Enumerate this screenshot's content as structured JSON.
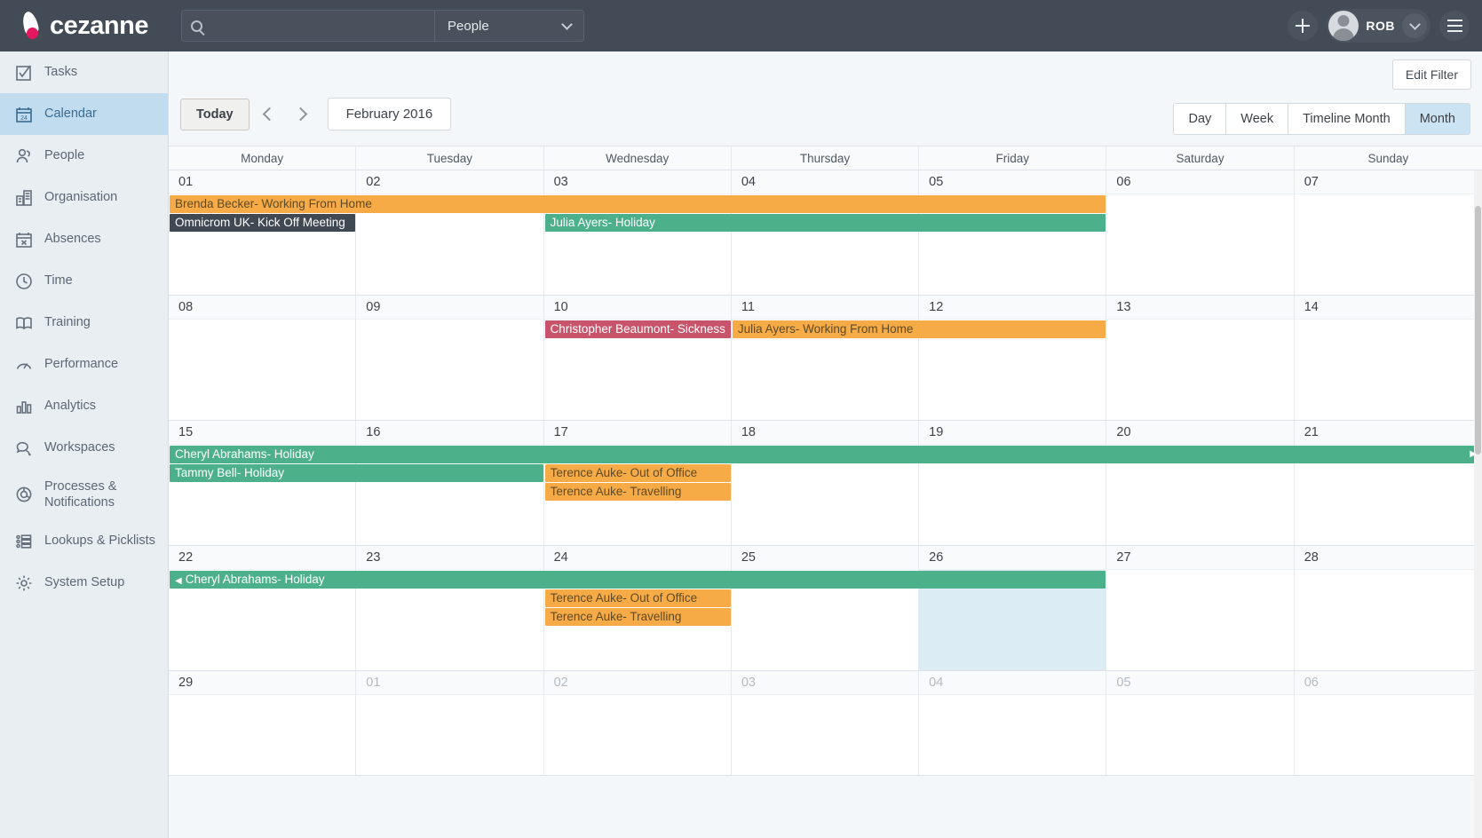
{
  "header": {
    "brand": "cezanne",
    "search": {
      "value": "",
      "placeholder": ""
    },
    "scope": "People",
    "scope_icon": "chevron-down-icon",
    "add_icon": "plus-icon",
    "user": "ROB",
    "menu_icon": "hamburger-icon"
  },
  "sidebar": {
    "items": [
      {
        "label": "Tasks",
        "icon": "checkbox-icon",
        "active": false
      },
      {
        "label": "Calendar",
        "icon": "calendar-icon",
        "active": true
      },
      {
        "label": "People",
        "icon": "people-icon",
        "active": false
      },
      {
        "label": "Organisation",
        "icon": "building-icon",
        "active": false
      },
      {
        "label": "Absences",
        "icon": "calendar-x-icon",
        "active": false
      },
      {
        "label": "Time",
        "icon": "clock-icon",
        "active": false
      },
      {
        "label": "Training",
        "icon": "book-icon",
        "active": false
      },
      {
        "label": "Performance",
        "icon": "gauge-icon",
        "active": false
      },
      {
        "label": "Analytics",
        "icon": "bar-chart-icon",
        "active": false
      },
      {
        "label": "Workspaces",
        "icon": "chat-bubbles-icon",
        "active": false
      },
      {
        "label": "Processes & Notifications",
        "icon": "process-circle-icon",
        "active": false
      },
      {
        "label": "Lookups & Picklists",
        "icon": "list-icon",
        "active": false
      },
      {
        "label": "System Setup",
        "icon": "gear-icon",
        "active": false
      }
    ]
  },
  "toolbar": {
    "edit_filter": "Edit Filter",
    "today": "Today",
    "prev_icon": "chevron-left-icon",
    "next_icon": "chevron-right-icon",
    "month_label": "February 2016",
    "views": [
      {
        "label": "Day",
        "active": false
      },
      {
        "label": "Week",
        "active": false
      },
      {
        "label": "Timeline Month",
        "active": false
      },
      {
        "label": "Month",
        "active": true
      }
    ]
  },
  "calendar": {
    "day_names": [
      "Monday",
      "Tuesday",
      "Wednesday",
      "Thursday",
      "Friday",
      "Saturday",
      "Sunday"
    ],
    "weeks": [
      {
        "days": [
          {
            "num": "01",
            "other": false,
            "highlight": false
          },
          {
            "num": "02",
            "other": false,
            "highlight": false
          },
          {
            "num": "03",
            "other": false,
            "highlight": false
          },
          {
            "num": "04",
            "other": false,
            "highlight": false
          },
          {
            "num": "05",
            "other": false,
            "highlight": false
          },
          {
            "num": "06",
            "other": false,
            "highlight": false
          },
          {
            "num": "07",
            "other": false,
            "highlight": false
          }
        ],
        "events": [
          {
            "title": "Brenda Becker- Working From Home",
            "color": "orange",
            "start": 0,
            "span": 5,
            "row": 0,
            "cont_left": false,
            "cont_right": false
          },
          {
            "title": "Omnicrom UK- Kick Off Meeting",
            "color": "dark",
            "start": 0,
            "span": 1,
            "row": 1,
            "cont_left": false,
            "cont_right": false
          },
          {
            "title": "Julia Ayers- Holiday",
            "color": "green",
            "start": 2,
            "span": 3,
            "row": 1,
            "cont_left": false,
            "cont_right": false
          }
        ]
      },
      {
        "days": [
          {
            "num": "08",
            "other": false,
            "highlight": false
          },
          {
            "num": "09",
            "other": false,
            "highlight": false
          },
          {
            "num": "10",
            "other": false,
            "highlight": false
          },
          {
            "num": "11",
            "other": false,
            "highlight": false
          },
          {
            "num": "12",
            "other": false,
            "highlight": false
          },
          {
            "num": "13",
            "other": false,
            "highlight": false
          },
          {
            "num": "14",
            "other": false,
            "highlight": false
          }
        ],
        "events": [
          {
            "title": "Christopher Beaumont- Sickness",
            "color": "red",
            "start": 2,
            "span": 1,
            "row": 0,
            "cont_left": false,
            "cont_right": false
          },
          {
            "title": "Julia Ayers- Working From Home",
            "color": "orange",
            "start": 3,
            "span": 2,
            "row": 0,
            "cont_left": false,
            "cont_right": false
          }
        ]
      },
      {
        "days": [
          {
            "num": "15",
            "other": false,
            "highlight": false
          },
          {
            "num": "16",
            "other": false,
            "highlight": false
          },
          {
            "num": "17",
            "other": false,
            "highlight": false
          },
          {
            "num": "18",
            "other": false,
            "highlight": false
          },
          {
            "num": "19",
            "other": false,
            "highlight": false
          },
          {
            "num": "20",
            "other": false,
            "highlight": false
          },
          {
            "num": "21",
            "other": false,
            "highlight": false
          }
        ],
        "events": [
          {
            "title": "Cheryl Abrahams- Holiday",
            "color": "green",
            "start": 0,
            "span": 7,
            "row": 0,
            "cont_left": false,
            "cont_right": true
          },
          {
            "title": "Tammy Bell- Holiday",
            "color": "green",
            "start": 0,
            "span": 2,
            "row": 1,
            "cont_left": false,
            "cont_right": false
          },
          {
            "title": "Terence Auke- Out of Office",
            "color": "orange",
            "start": 2,
            "span": 1,
            "row": 1,
            "cont_left": false,
            "cont_right": false
          },
          {
            "title": "Terence Auke- Travelling",
            "color": "orange",
            "start": 2,
            "span": 1,
            "row": 2,
            "cont_left": false,
            "cont_right": false
          }
        ]
      },
      {
        "days": [
          {
            "num": "22",
            "other": false,
            "highlight": false
          },
          {
            "num": "23",
            "other": false,
            "highlight": false
          },
          {
            "num": "24",
            "other": false,
            "highlight": false
          },
          {
            "num": "25",
            "other": false,
            "highlight": false
          },
          {
            "num": "26",
            "other": false,
            "highlight": true
          },
          {
            "num": "27",
            "other": false,
            "highlight": false
          },
          {
            "num": "28",
            "other": false,
            "highlight": false
          }
        ],
        "events": [
          {
            "title": "Cheryl Abrahams- Holiday",
            "color": "green",
            "start": 0,
            "span": 5,
            "row": 0,
            "cont_left": true,
            "cont_right": false
          },
          {
            "title": "Terence Auke- Out of Office",
            "color": "orange",
            "start": 2,
            "span": 1,
            "row": 1,
            "cont_left": false,
            "cont_right": false
          },
          {
            "title": "Terence Auke- Travelling",
            "color": "orange",
            "start": 2,
            "span": 1,
            "row": 2,
            "cont_left": false,
            "cont_right": false
          }
        ]
      },
      {
        "days": [
          {
            "num": "29",
            "other": false,
            "highlight": false
          },
          {
            "num": "01",
            "other": true,
            "highlight": false
          },
          {
            "num": "02",
            "other": true,
            "highlight": false
          },
          {
            "num": "03",
            "other": true,
            "highlight": false
          },
          {
            "num": "04",
            "other": true,
            "highlight": false
          },
          {
            "num": "05",
            "other": true,
            "highlight": false
          },
          {
            "num": "06",
            "other": true,
            "highlight": false
          }
        ],
        "events": []
      }
    ]
  },
  "colors": {
    "topbar": "#434b56",
    "brand_pink": "#e5175e",
    "sidebar_bg": "#e9eef2",
    "active_nav": "#c1dcef",
    "event_green": "#4cb18a",
    "event_orange": "#f7ab46",
    "event_dark": "#3f4853",
    "event_red": "#c8546b",
    "today_cell": "#dcecf4"
  }
}
